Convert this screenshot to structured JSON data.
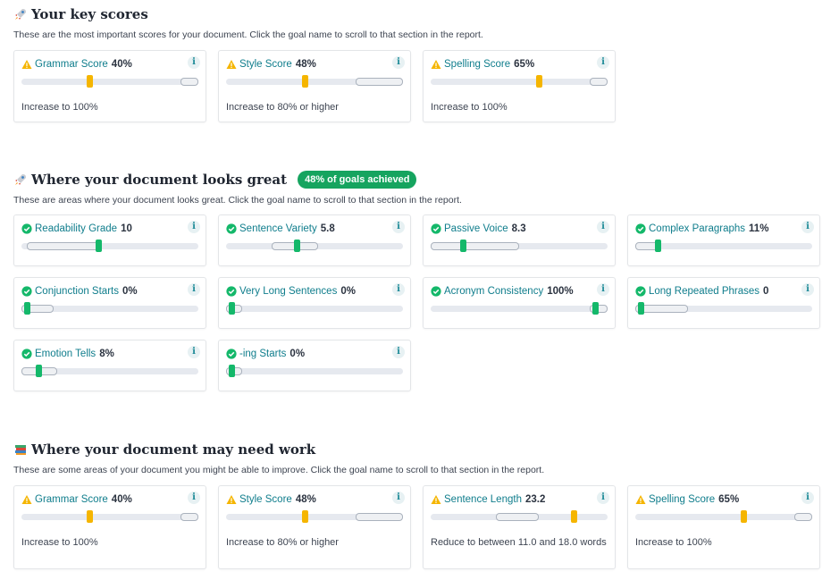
{
  "colors": {
    "warning": "#f5b500",
    "success": "#14b86a",
    "link": "#0f7d8c",
    "badge": "#16a45f"
  },
  "key_scores": {
    "title": "Your key scores",
    "icon": "rocket-icon",
    "description": "These are the most important scores for your document. Click the goal name to scroll to that section in the report.",
    "cards": [
      {
        "name": "Grammar Score",
        "value": "40%",
        "status": "warning",
        "note": "Increase to 100%",
        "thumb_pct": 0.385,
        "target": [
          0.9,
          1.0
        ]
      },
      {
        "name": "Style Score",
        "value": "48%",
        "status": "warning",
        "note": "Increase to 80% or higher",
        "thumb_pct": 0.445,
        "target": [
          0.73,
          1.0
        ]
      },
      {
        "name": "Spelling Score",
        "value": "65%",
        "status": "warning",
        "note": "Increase to 100%",
        "thumb_pct": 0.61,
        "target": [
          0.9,
          1.0
        ]
      }
    ]
  },
  "looks_great": {
    "title": "Where your document looks great",
    "icon": "rocket-icon",
    "badge": "48% of goals achieved",
    "description": "These are areas where your document looks great. Click the goal name to scroll to that section in the report.",
    "cards": [
      {
        "name": "Readability Grade",
        "value": "10",
        "status": "success",
        "thumb_pct": 0.435,
        "target": [
          0.03,
          0.44
        ]
      },
      {
        "name": "Sentence Variety",
        "value": "5.8",
        "status": "success",
        "thumb_pct": 0.4,
        "target": [
          0.26,
          0.52
        ]
      },
      {
        "name": "Passive Voice",
        "value": "8.3",
        "status": "success",
        "thumb_pct": 0.18,
        "target": [
          0.0,
          0.5
        ]
      },
      {
        "name": "Complex Paragraphs",
        "value": "11%",
        "status": "success",
        "thumb_pct": 0.125,
        "target": [
          0.0,
          0.13
        ]
      },
      {
        "name": "Conjunction Starts",
        "value": "0%",
        "status": "success",
        "thumb_pct": 0.03,
        "target": [
          0.0,
          0.18
        ]
      },
      {
        "name": "Very Long Sentences",
        "value": "0%",
        "status": "success",
        "thumb_pct": 0.03,
        "target": [
          0.0,
          0.09
        ]
      },
      {
        "name": "Acronym Consistency",
        "value": "100%",
        "status": "success",
        "thumb_pct": 0.93,
        "target": [
          0.9,
          1.0
        ]
      },
      {
        "name": "Long Repeated Phrases",
        "value": "0",
        "status": "success",
        "thumb_pct": 0.03,
        "target": [
          0.0,
          0.3
        ]
      },
      {
        "name": "Emotion Tells",
        "value": "8%",
        "status": "success",
        "thumb_pct": 0.095,
        "target": [
          0.0,
          0.2
        ]
      },
      {
        "name": "-ing Starts",
        "value": "0%",
        "status": "success",
        "thumb_pct": 0.03,
        "target": [
          0.0,
          0.09
        ]
      }
    ]
  },
  "needs_work": {
    "title": "Where your document may need work",
    "icon": "books-icon",
    "description": "These are some areas of your document you might be able to improve. Click the goal name to scroll to that section in the report.",
    "cards": [
      {
        "name": "Grammar Score",
        "value": "40%",
        "status": "warning",
        "note": "Increase to 100%",
        "thumb_pct": 0.385,
        "target": [
          0.9,
          1.0
        ]
      },
      {
        "name": "Style Score",
        "value": "48%",
        "status": "warning",
        "note": "Increase to 80% or higher",
        "thumb_pct": 0.445,
        "target": [
          0.73,
          1.0
        ]
      },
      {
        "name": "Sentence Length",
        "value": "23.2",
        "status": "warning",
        "note": "Reduce to between 11.0 and 18.0 words",
        "thumb_pct": 0.81,
        "target": [
          0.37,
          0.61
        ]
      },
      {
        "name": "Spelling Score",
        "value": "65%",
        "status": "warning",
        "note": "Increase to 100%",
        "thumb_pct": 0.61,
        "target": [
          0.9,
          1.0
        ]
      }
    ]
  },
  "info_glyph": "i"
}
